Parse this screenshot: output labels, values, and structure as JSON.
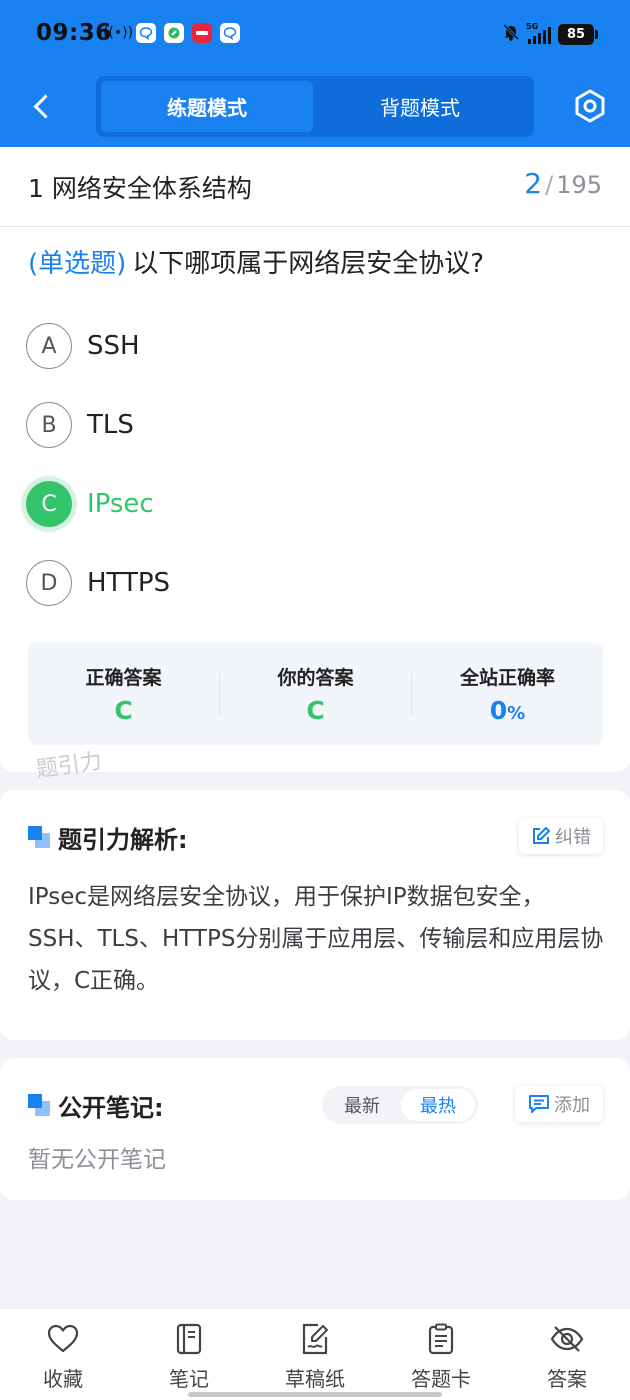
{
  "status_bar": {
    "time": "09:36",
    "signal_tag": "5G",
    "battery": "85",
    "notification_icons": [
      "hotspot-icon",
      "chat-bubble-icon",
      "green-app-icon",
      "red-app-icon",
      "chat-bubble-icon"
    ]
  },
  "header": {
    "modes": [
      "练题模式",
      "背题模式"
    ],
    "active_mode": "练题模式",
    "accent_color": "#1a82f0"
  },
  "chapter": {
    "title": "1 网络安全体系结构",
    "current": "2",
    "separator": "/",
    "total": "195"
  },
  "question": {
    "type_label": "(单选题)",
    "text": "以下哪项属于网络层安全协议?",
    "options": [
      {
        "letter": "A",
        "text": "SSH"
      },
      {
        "letter": "B",
        "text": "TLS"
      },
      {
        "letter": "C",
        "text": "IPsec",
        "state": "correct"
      },
      {
        "letter": "D",
        "text": "HTTPS"
      }
    ]
  },
  "answer_summary": {
    "correct_label": "正确答案",
    "correct_value": "C",
    "yours_label": "你的答案",
    "yours_value": "C",
    "rate_label": "全站正确率",
    "rate_value": "0",
    "rate_unit": "%"
  },
  "watermark": "题引力",
  "analysis": {
    "title": "题引力解析:",
    "report_button": "纠错",
    "text": "IPsec是网络层安全协议，用于保护IP数据包安全，SSH、TLS、HTTPS分别属于应用层、传输层和应用层协议，C正确。"
  },
  "notes": {
    "title": "公开笔记:",
    "sort_options": [
      "最新",
      "最热"
    ],
    "active_sort": "最热",
    "add_button": "添加",
    "empty_text": "暂无公开笔记"
  },
  "bottom_bar": {
    "items": [
      {
        "label": "收藏",
        "icon": "heart-icon"
      },
      {
        "label": "笔记",
        "icon": "notebook-icon"
      },
      {
        "label": "草稿纸",
        "icon": "draft-icon"
      },
      {
        "label": "答题卡",
        "icon": "answer-sheet-icon"
      },
      {
        "label": "答案",
        "icon": "eye-off-icon"
      }
    ]
  },
  "colors": {
    "primary": "#1a82f0",
    "correct": "#33c46d",
    "background": "#f1f3f7"
  }
}
